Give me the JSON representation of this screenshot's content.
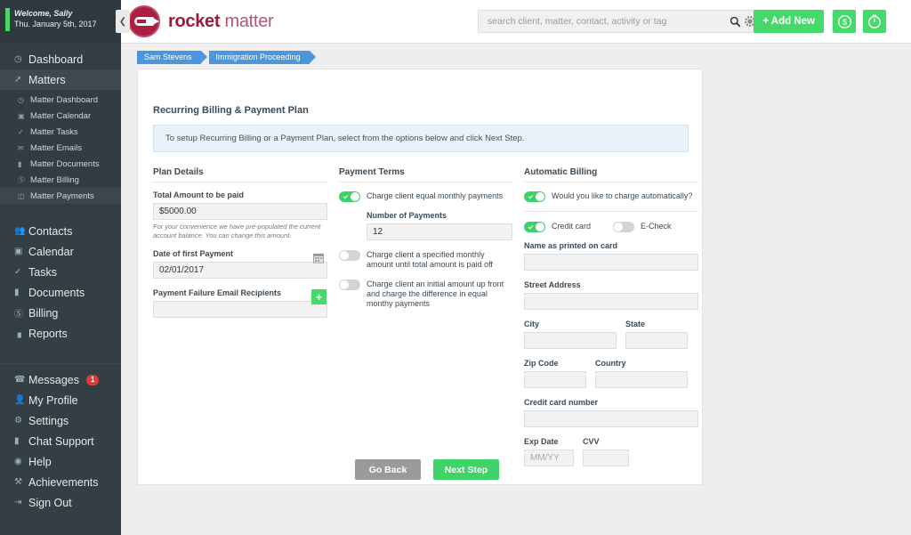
{
  "sidebar": {
    "welcome": {
      "line1": "Welcome, Sally",
      "line2": "Thu. January 5th, 2017"
    },
    "collapse_icon": "chevron-left-icon",
    "items": [
      {
        "label": "Dashboard",
        "icon": "gauge-icon",
        "active": false
      },
      {
        "label": "Matters",
        "icon": "gavel-icon",
        "active": true
      },
      {
        "label": "Contacts",
        "icon": "people-icon",
        "active": false
      },
      {
        "label": "Calendar",
        "icon": "calendar-icon",
        "active": false
      },
      {
        "label": "Tasks",
        "icon": "check-icon",
        "active": false
      },
      {
        "label": "Documents",
        "icon": "folder-icon",
        "active": false
      },
      {
        "label": "Billing",
        "icon": "dollar-circle-icon",
        "active": false
      },
      {
        "label": "Reports",
        "icon": "bar-chart-icon",
        "active": false
      }
    ],
    "submenu": [
      {
        "label": "Matter Dashboard",
        "icon": "gauge-icon",
        "active": false
      },
      {
        "label": "Matter Calendar",
        "icon": "calendar-icon",
        "active": false
      },
      {
        "label": "Matter Tasks",
        "icon": "check-icon",
        "active": false
      },
      {
        "label": "Matter Emails",
        "icon": "envelope-icon",
        "active": false
      },
      {
        "label": "Matter Documents",
        "icon": "folder-icon",
        "active": false
      },
      {
        "label": "Matter Billing",
        "icon": "dollar-circle-icon",
        "active": false
      },
      {
        "label": "Matter Payments",
        "icon": "card-icon",
        "active": true
      }
    ],
    "footer_items": [
      {
        "label": "Messages",
        "icon": "phone-icon",
        "badge": "1"
      },
      {
        "label": "My Profile",
        "icon": "user-icon",
        "badge": ""
      },
      {
        "label": "Settings",
        "icon": "gear-icon",
        "badge": ""
      },
      {
        "label": "Chat Support",
        "icon": "chat-icon",
        "badge": ""
      },
      {
        "label": "Help",
        "icon": "help-circle-icon",
        "badge": ""
      },
      {
        "label": "Achievements",
        "icon": "trophy-icon",
        "badge": ""
      },
      {
        "label": "Sign Out",
        "icon": "sign-out-icon",
        "badge": ""
      }
    ]
  },
  "topbar": {
    "logo_bold": "rocket",
    "logo_normal": " matter",
    "search_placeholder": "search client, matter, contact, activity or tag",
    "search_value": "",
    "search_icon": "search-icon",
    "settings_icon": "gear-icon",
    "add_new_label": "+ Add New",
    "money_icon": "dollar-circle-icon",
    "timer_icon": "timer-icon"
  },
  "breadcrumbs": [
    {
      "label": "Sam Stevens"
    },
    {
      "label": "Immigration Proceeding"
    }
  ],
  "page": {
    "title": "Recurring Billing & Payment Plan",
    "info": "To setup Recurring Billing or a Payment Plan, select from the options below and click Next Step."
  },
  "plan_details": {
    "heading": "Plan Details",
    "total_label": "Total Amount to be paid",
    "total_value": "$5000.00",
    "total_hint": "For your convenience we have pre-populated the current account balance. You can change this amount.",
    "date_label": "Date of first Payment",
    "date_value": "02/01/2017",
    "date_icon": "calendar-icon",
    "email_label": "Payment Failure Email Recipients",
    "email_value": "",
    "email_placeholder": "",
    "add_icon": "plus-icon"
  },
  "payment_terms": {
    "heading": "Payment Terms",
    "option1_label": "Charge client equal monthly payments",
    "option1_on": true,
    "num_payments_label": "Number of Payments",
    "num_payments_value": "12",
    "option2_label": "Charge client a specified monthly amount until total amount is paid off",
    "option2_on": false,
    "option3_label": "Charge client an initial amount up front and charge the difference in equal monthy payments",
    "option3_on": false
  },
  "automatic_billing": {
    "heading": "Automatic Billing",
    "auto_label": "Would you like to charge automatically?",
    "auto_on": true,
    "credit_card_label": "Credit card",
    "credit_card_on": true,
    "echeck_label": "E-Check",
    "echeck_on": false,
    "name_label": "Name as printed on card",
    "name_value": "",
    "street_label": "Street Address",
    "street_value": "",
    "city_label": "City",
    "city_value": "",
    "state_label": "State",
    "state_value": "",
    "zip_label": "Zip Code",
    "zip_value": "",
    "country_label": "Country",
    "country_value": "",
    "cc_label": "Credit card number",
    "cc_value": "",
    "exp_label": "Exp Date",
    "exp_value": "",
    "exp_placeholder": "MM/YY",
    "cvv_label": "CVV",
    "cvv_value": ""
  },
  "actions": {
    "back_label": "Go Back",
    "next_label": "Next Step"
  },
  "colors": {
    "brand_green": "#44d96a",
    "sidebar_bg": "#343f44",
    "breadcrumb_blue": "#4b96dd",
    "logo_maroon": "#a81f41",
    "badge_red": "#e03b3b"
  }
}
